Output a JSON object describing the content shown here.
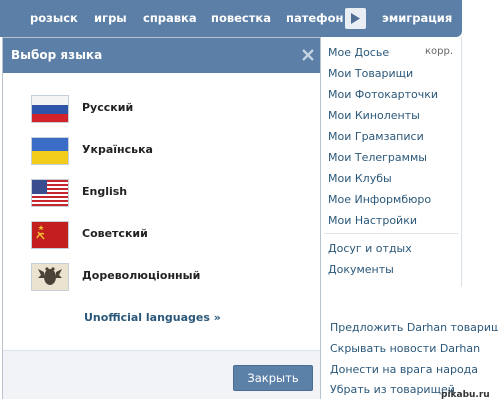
{
  "nav": {
    "items": [
      "розыск",
      "игры",
      "справка",
      "повестка",
      "патефон",
      "эмиграция"
    ],
    "play_icon": "play-triangle-icon"
  },
  "sidebar": {
    "items": [
      {
        "label": "Мое Досье",
        "badge": "корр."
      },
      {
        "label": "Мои Товарищи"
      },
      {
        "label": "Мои Фотокарточки"
      },
      {
        "label": "Мои Киноленты"
      },
      {
        "label": "Мои Грамзаписи"
      },
      {
        "label": "Мои Телеграммы"
      },
      {
        "label": "Мои Клубы"
      },
      {
        "label": "Мое Информбюро"
      },
      {
        "label": "Мои Настройки"
      }
    ],
    "extra_items": [
      "Досуг и отдых",
      "Документы"
    ]
  },
  "actions": [
    "Предложить Darhan товарищей",
    "Скрывать новости Darhan",
    "Донести на врага народа",
    "Убрать из товарищей"
  ],
  "modal": {
    "title": "Выбор языка",
    "languages": [
      {
        "label": "Русский",
        "flag": "russia-flag-icon"
      },
      {
        "label": "Українська",
        "flag": "ukraine-flag-icon"
      },
      {
        "label": "English",
        "flag": "usa-flag-icon"
      },
      {
        "label": "Советский",
        "flag": "ussr-flag-icon"
      },
      {
        "label": "Дореволюціонный",
        "flag": "imperial-eagle-icon"
      }
    ],
    "unofficial_link": "Unofficial languages »",
    "close_button": "Закрыть"
  },
  "colors": {
    "header": "#5b7fa6",
    "link": "#2b587a",
    "button": "#5c81a8"
  },
  "watermark": "pikabu.ru"
}
